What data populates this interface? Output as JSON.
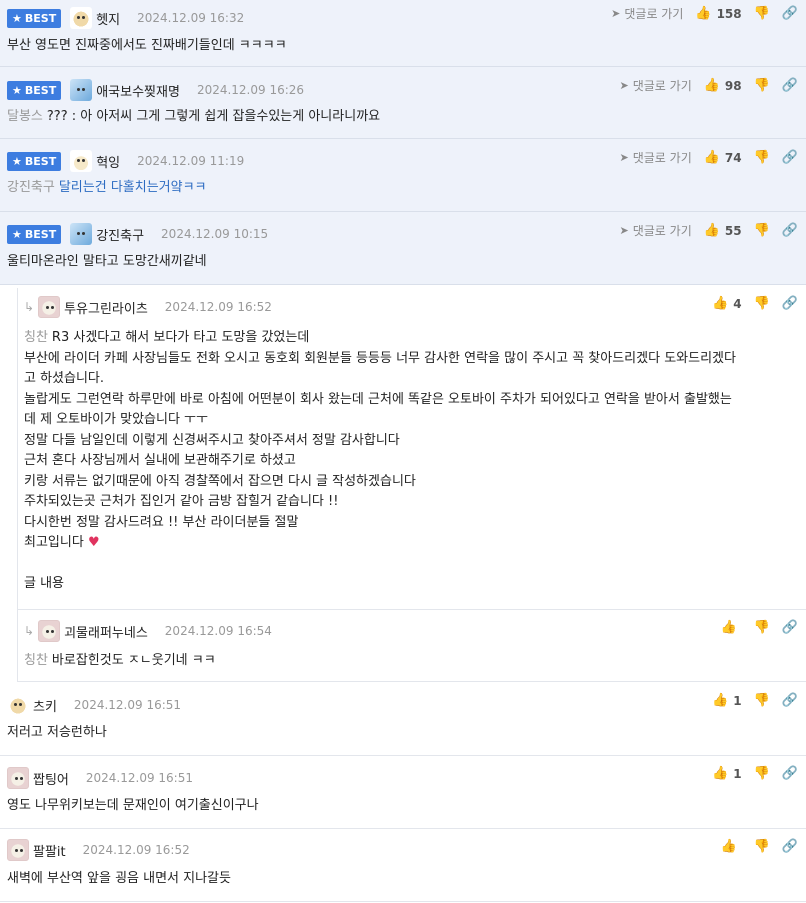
{
  "common": {
    "best_label": "BEST",
    "goto_label": "댓글로 가기"
  },
  "best_comments": [
    {
      "nick": "헷지",
      "date": "2024.12.09 16:32",
      "likes": "158",
      "mention": "",
      "text": "부산 영도면 진짜중에서도 진짜배기들인데 ㅋㅋㅋㅋ",
      "avatar": "dog"
    },
    {
      "nick": "애국보수찢재명",
      "date": "2024.12.09 16:26",
      "likes": "98",
      "mention": "달봉스",
      "text": "??? : 아 아저씨 그게 그렇게 쉽게 잡을수있는게 아니라니까요",
      "avatar": "blue"
    },
    {
      "nick": "혁잉",
      "date": "2024.12.09 11:19",
      "likes": "74",
      "mention": "강진축구",
      "text": "달리는건 다홀치는거얔ㅋㅋ",
      "avatar": "fox"
    },
    {
      "nick": "강진축구",
      "date": "2024.12.09 10:15",
      "likes": "55",
      "mention": "",
      "text": "울티마온라인 말타고 도망간새끼같네",
      "avatar": "blue"
    }
  ],
  "reply_main": {
    "nick": "투유그린라이츠",
    "date": "2024.12.09 16:52",
    "likes": "4",
    "mention": "칭찬",
    "lines": [
      "R3 사겠다고 해서 보다가 타고 도망을 갔었는데",
      "부산에 라이더 카페 사장님들도 전화 오시고 동호회 회원분들 등등등 너무 감사한 연락을 많이 주시고 꼭 찾아드리겠다 도와드리겠다",
      "고 하셨습니다.",
      "놀랍게도 그런연락 하루만에 바로 아침에 어떤분이 회사 왔는데 근처에 똑같은 오토바이 주차가 되어있다고 연락을 받아서 출발했는",
      "데 제 오토바이가 맞았습니다 ㅜㅜ",
      "정말 다들 남일인데 이렇게 신경써주시고 찾아주셔서 정말 감사합니다",
      "근처 혼다 사장님께서 실내에 보관해주기로 하셨고",
      "키랑 서류는 없기때문에 아직 경찰쪽에서 잡으면 다시 글 작성하겠습니다",
      "주차되있는곳 근처가 집인거 같아 금방 잡힐거 같습니다 !!",
      "다시한번 정말 감사드려요 !! 부산 라이더분들 절말",
      "최고입니다",
      "",
      "글 내용"
    ],
    "heart": "♥"
  },
  "reply_sub": {
    "nick": "괴물래퍼누네스",
    "date": "2024.12.09 16:54",
    "likes": "",
    "mention": "칭찬",
    "text": "바로잡힌것도 ㅈㄴ웃기네 ㅋㅋ"
  },
  "comments": [
    {
      "nick": "츠키",
      "date": "2024.12.09 16:51",
      "likes": "1",
      "text": "저러고 저승런하나",
      "avatar": "dog"
    },
    {
      "nick": "짭팅어",
      "date": "2024.12.09 16:51",
      "likes": "1",
      "text": "영도 나무위키보는데 문재인이 여기출신이구나",
      "avatar": "dog2"
    },
    {
      "nick": "팔팔it",
      "date": "2024.12.09 16:52",
      "likes": "",
      "text": "새벽에 부산역 앞을 굉음 내면서 지나갈듯",
      "avatar": "dog2"
    }
  ],
  "icons": {
    "star": "star-icon",
    "goto": "arrow-icon",
    "like": "thumbs-up-icon",
    "dislike": "thumbs-down-icon",
    "link": "link-icon",
    "reply": "reply-arrow-icon"
  }
}
